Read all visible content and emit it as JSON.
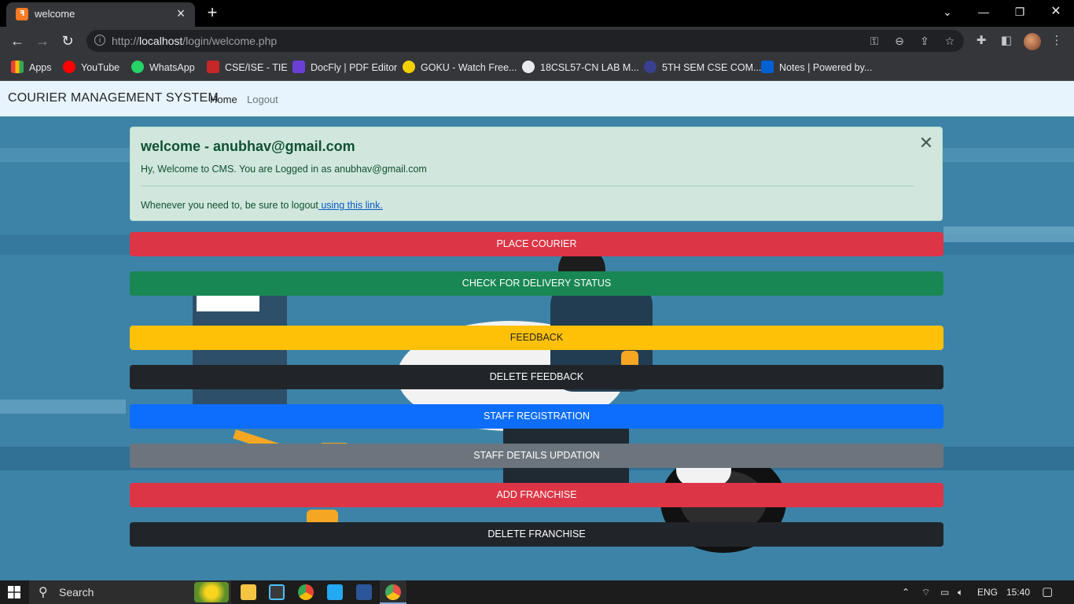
{
  "browser": {
    "tab_title": "welcome",
    "tab_favicon": "xampp-icon",
    "url_prefix": "http://",
    "url_host": "localhost",
    "url_path": "/login/welcome.php",
    "bookmarks": [
      {
        "label": "Apps",
        "icon": "apps-grid-icon",
        "color": "#ea4335"
      },
      {
        "label": "YouTube",
        "icon": "youtube-icon",
        "color": "#ff0000"
      },
      {
        "label": "WhatsApp",
        "icon": "whatsapp-icon",
        "color": "#25d366"
      },
      {
        "label": "CSE/ISE - TIE",
        "icon": "tie-icon",
        "color": "#c62828"
      },
      {
        "label": "DocFly | PDF Editor",
        "icon": "docfly-icon",
        "color": "#6a3fd6"
      },
      {
        "label": "GOKU - Watch Free...",
        "icon": "goku-icon",
        "color": "#f5d000"
      },
      {
        "label": "18CSL57-CN LAB M...",
        "icon": "globe-icon",
        "color": "#e8eaed"
      },
      {
        "label": "5TH SEM CSE COM...",
        "icon": "moon-icon",
        "color": "#5c6bc0"
      },
      {
        "label": "Notes | Powered by...",
        "icon": "box-icon",
        "color": "#0061d5"
      }
    ]
  },
  "navbar": {
    "brand": "COURIER MANAGEMENT SYSTEM",
    "home": "Home",
    "logout": "Logout"
  },
  "alert": {
    "heading": "welcome - anubhav@gmail.com",
    "text": "Hy, Welcome to CMS. You are Logged in as anubhav@gmail.com",
    "footer_text": "Whenever you need to, be sure to logout",
    "footer_link": " using this link.",
    "close_symbol": "✕"
  },
  "buttons": [
    {
      "label": "PLACE COURIER",
      "bg": "#dc3545",
      "fg": "#ffffff"
    },
    {
      "label": "CHECK FOR DELIVERY STATUS",
      "bg": "#198754",
      "fg": "#ffffff"
    },
    {
      "label": "FEEDBACK",
      "bg": "#ffc107",
      "fg": "#212529"
    },
    {
      "label": "DELETE FEEDBACK",
      "bg": "#212529",
      "fg": "#ffffff"
    },
    {
      "label": "STAFF REGISTRATION",
      "bg": "#0d6efd",
      "fg": "#ffffff"
    },
    {
      "label": "STAFF DETAILS UPDATION",
      "bg": "#6c757d",
      "fg": "#ffffff"
    },
    {
      "label": "ADD FRANCHISE",
      "bg": "#dc3545",
      "fg": "#ffffff"
    },
    {
      "label": "DELETE FRANCHISE",
      "bg": "#212529",
      "fg": "#ffffff"
    }
  ],
  "taskbar": {
    "search_placeholder": "Search",
    "language": "ENG",
    "time": "15:40"
  }
}
